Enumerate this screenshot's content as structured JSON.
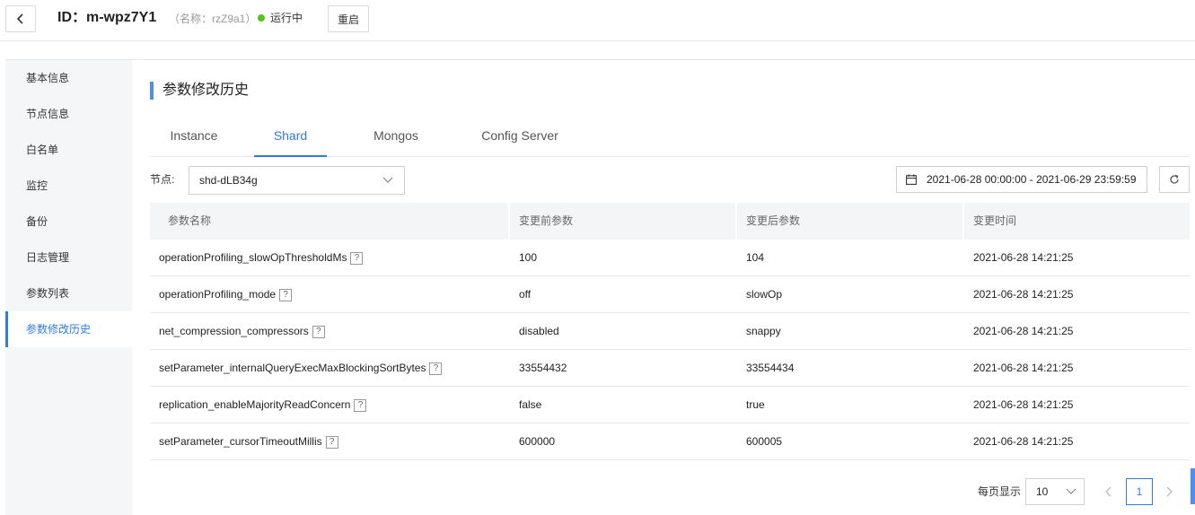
{
  "header": {
    "title": "ID：m-wpz7Y1",
    "alias": "（名称：rzZ9a1）",
    "status": "运行中",
    "restart_label": "重启",
    "status_color": "#52c41a"
  },
  "sidebar": {
    "items": [
      {
        "label": "基本信息"
      },
      {
        "label": "节点信息"
      },
      {
        "label": "白名单"
      },
      {
        "label": "监控"
      },
      {
        "label": "备份"
      },
      {
        "label": "日志管理"
      },
      {
        "label": "参数列表"
      },
      {
        "label": "参数修改历史",
        "active": true
      }
    ]
  },
  "main": {
    "section_title": "参数修改历史",
    "tabs": [
      {
        "label": "Instance"
      },
      {
        "label": "Shard",
        "active": true
      },
      {
        "label": "Mongos"
      },
      {
        "label": "Config Server"
      }
    ],
    "node_label": "节点:",
    "node_value": "shd-dLB34g",
    "date_range": "2021-06-28 00:00:00 - 2021-06-29 23:59:59"
  },
  "table": {
    "headers": [
      "参数名称",
      "变更前参数",
      "变更后参数",
      "变更时间"
    ],
    "help_glyph": "?",
    "rows": [
      {
        "name": "operationProfiling_slowOpThresholdMs",
        "before": "100",
        "after": "104",
        "time": "2021-06-28 14:21:25"
      },
      {
        "name": "operationProfiling_mode",
        "before": "off",
        "after": "slowOp",
        "time": "2021-06-28 14:21:25"
      },
      {
        "name": "net_compression_compressors",
        "before": "disabled",
        "after": "snappy",
        "time": "2021-06-28 14:21:25"
      },
      {
        "name": "setParameter_internalQueryExecMaxBlockingSortBytes",
        "before": "33554432",
        "after": "33554434",
        "time": "2021-06-28 14:21:25"
      },
      {
        "name": "replication_enableMajorityReadConcern",
        "before": "false",
        "after": "true",
        "time": "2021-06-28 14:21:25"
      },
      {
        "name": "setParameter_cursorTimeoutMillis",
        "before": "600000",
        "after": "600005",
        "time": "2021-06-28 14:21:25"
      }
    ]
  },
  "pagination": {
    "page_size_label": "每页显示",
    "page_size": "10",
    "current_page": "1"
  },
  "colors": {
    "accent": "#2d7be5",
    "section_bar": "#4d8ef0"
  }
}
